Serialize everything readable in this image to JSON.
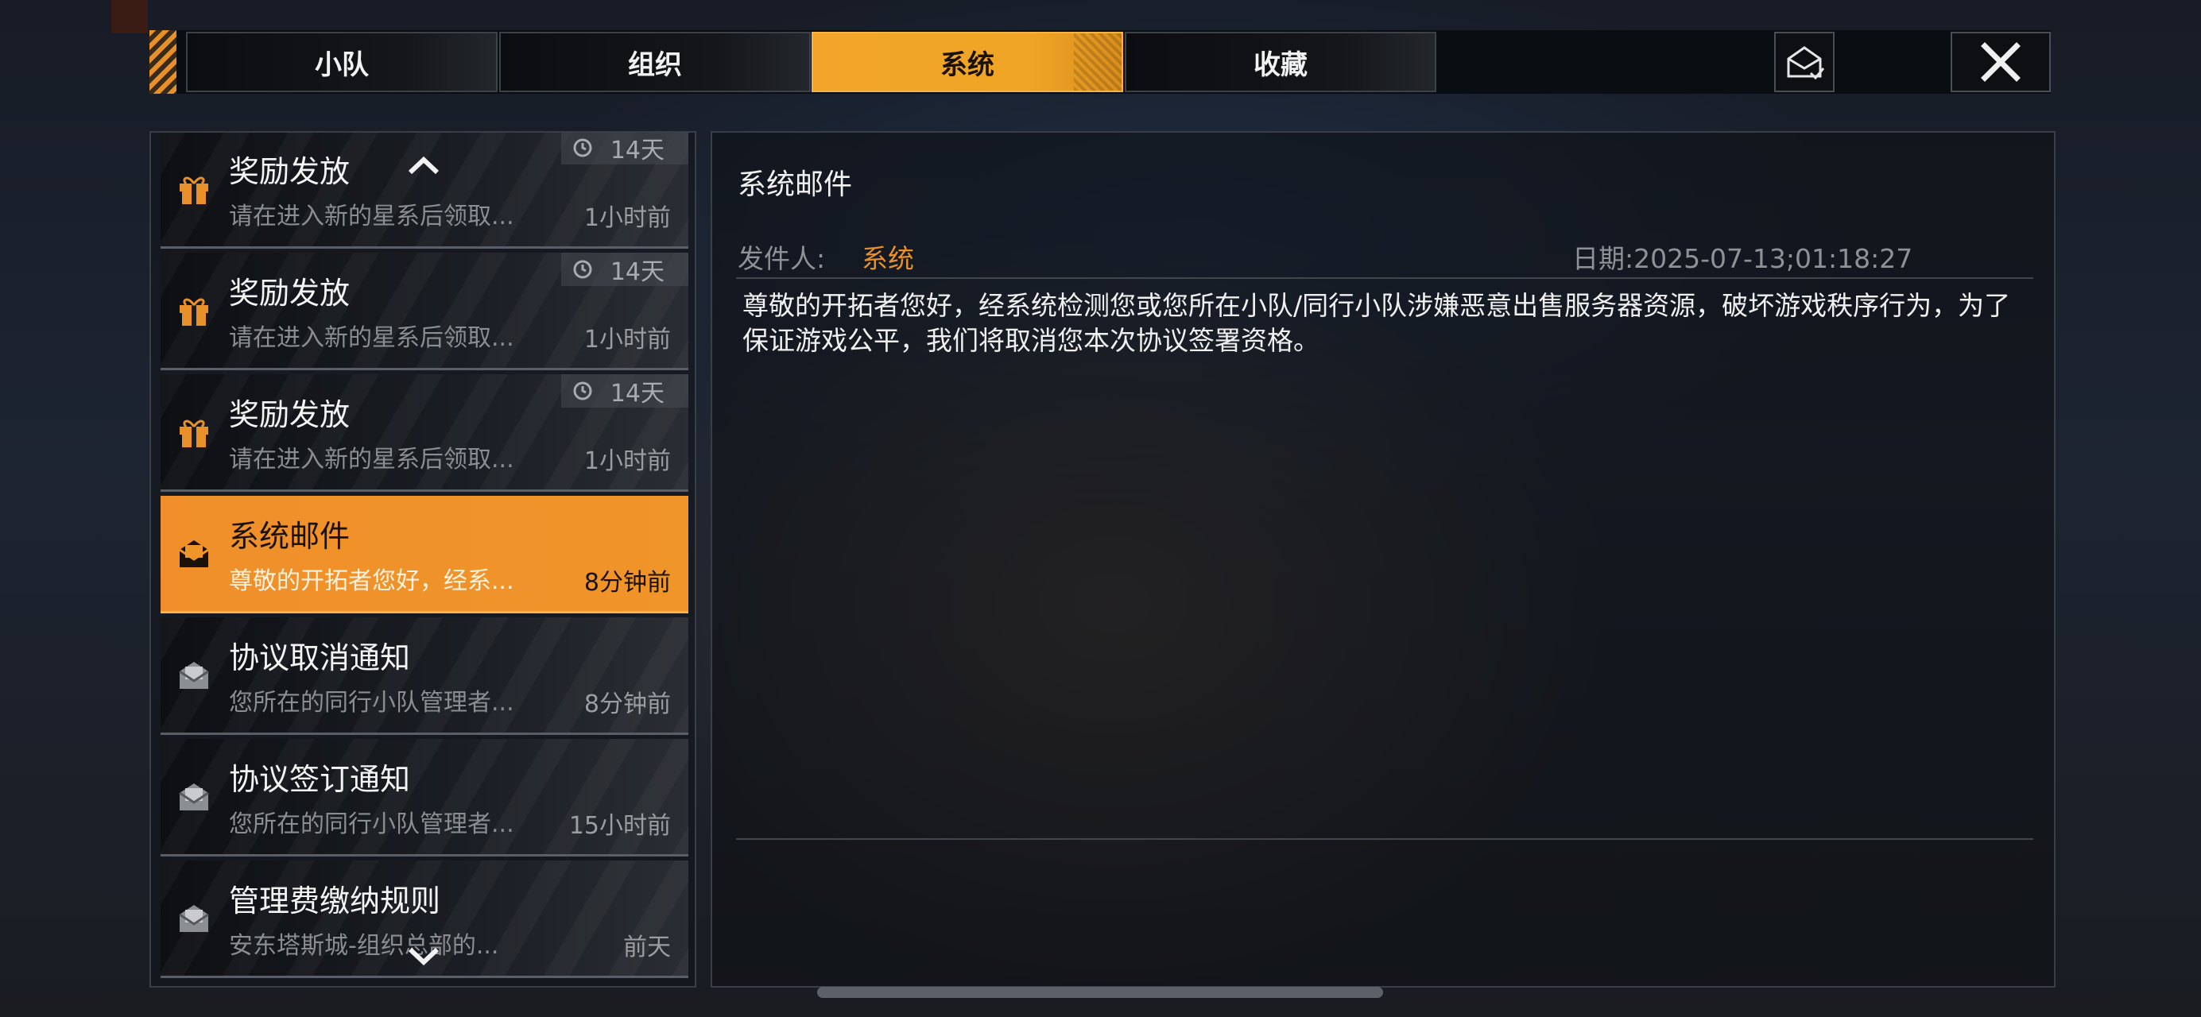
{
  "tabs": [
    {
      "label": "小队",
      "active": false
    },
    {
      "label": "组织",
      "active": false
    },
    {
      "label": "系统",
      "active": true
    },
    {
      "label": "收藏",
      "active": false
    }
  ],
  "toolbar": {
    "read_all_icon": "envelope-check-icon",
    "close_icon": "close-icon"
  },
  "mail_list": [
    {
      "title": "奖励发放",
      "preview": "请在进入新的星系后领取...",
      "time": "1小时前",
      "expiry": "14天",
      "icon": "gift-icon"
    },
    {
      "title": "奖励发放",
      "preview": "请在进入新的星系后领取...",
      "time": "1小时前",
      "expiry": "14天",
      "icon": "gift-icon"
    },
    {
      "title": "奖励发放",
      "preview": "请在进入新的星系后领取...",
      "time": "1小时前",
      "expiry": "14天",
      "icon": "gift-icon"
    },
    {
      "title": "系统邮件",
      "preview": "尊敬的开拓者您好，经系...",
      "time": "8分钟前",
      "icon": "open-mail-icon",
      "selected": true
    },
    {
      "title": "协议取消通知",
      "preview": "您所在的同行小队管理者...",
      "time": "8分钟前",
      "icon": "open-mail-icon"
    },
    {
      "title": "协议签订通知",
      "preview": "您所在的同行小队管理者...",
      "time": "15小时前",
      "icon": "open-mail-icon"
    },
    {
      "title": "管理费缴纳规则",
      "preview": "安东塔斯城-组织总部的...",
      "time": "前天",
      "icon": "open-mail-icon"
    }
  ],
  "detail": {
    "title": "系统邮件",
    "sender_label": "发件人:",
    "sender": "系统",
    "date": "日期:2025-07-13;01:18:27",
    "body": "尊敬的开拓者您好，经系统检测您或您所在小队/同行小队涉嫌恶意出售服务器资源，破坏游戏秩序行为，为了保证游戏公平，我们将取消您本次协议签署资格。"
  },
  "colors": {
    "accent": "#f0952a",
    "tab_active": "#f0a526"
  }
}
